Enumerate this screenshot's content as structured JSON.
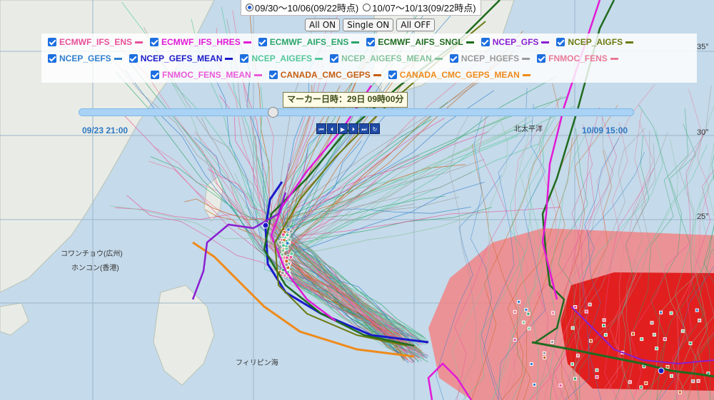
{
  "period_options": [
    {
      "label": "09/30〜10/06(09/22時点)",
      "selected": true
    },
    {
      "label": "10/07〜10/13(09/22時点)",
      "selected": false
    }
  ],
  "buttons": {
    "all_on": "All ON",
    "single_on": "Single ON",
    "all_off": "All OFF"
  },
  "legend": {
    "rows": [
      [
        {
          "label": "ECMWF_IFS_ENS",
          "color": "#e8509a",
          "checked": true
        },
        {
          "label": "ECMWF_IFS_HRES",
          "color": "#e11ad6",
          "checked": true
        },
        {
          "label": "ECMWF_AIFS_ENS",
          "color": "#2aa56a",
          "checked": true
        },
        {
          "label": "ECMWF_AIFS_SNGL",
          "color": "#1f6b1f",
          "checked": true
        },
        {
          "label": "NCEP_GFS",
          "color": "#8a1fd2",
          "checked": true
        },
        {
          "label": "NCEP_AIGFS",
          "color": "#6b7a10",
          "checked": true
        }
      ],
      [
        {
          "label": "NCEP_GEFS",
          "color": "#2f7fcf",
          "checked": true
        },
        {
          "label": "NCEP_GEFS_MEAN",
          "color": "#1a1ac9",
          "checked": true
        },
        {
          "label": "NCEP_AIGEFS",
          "color": "#53c79a",
          "checked": true
        },
        {
          "label": "NCEP_AIGEFS_MEAN",
          "color": "#86c49e",
          "checked": true
        },
        {
          "label": "NCEP_HGEFS",
          "color": "#9a9a9a",
          "checked": true
        },
        {
          "label": "FNMOC_FENS",
          "color": "#e87a98",
          "checked": true
        }
      ],
      [
        {
          "label": "FNMOC_FENS_MEAN",
          "color": "#ea5ad8",
          "checked": true
        },
        {
          "label": "CANADA_CMC_GEPS",
          "color": "#c75d10",
          "checked": true
        },
        {
          "label": "CANADA_CMC_GEPS_MEAN",
          "color": "#ef8a1a",
          "checked": true
        }
      ]
    ]
  },
  "marker_time": "マーカー日時：29日 09時00分",
  "timeline": {
    "start": "09/23 21:00",
    "end": "10/09 15:00",
    "position": 0.35
  },
  "playback_controls": [
    "first",
    "prev",
    "play",
    "next",
    "last",
    "repeat"
  ],
  "lat_labels": [
    "35°",
    "30°",
    "25°"
  ],
  "place_names": [
    "ホンコン(香港)",
    "コワンチョウ(広州)",
    "フィリピン海",
    "北太平洋"
  ]
}
